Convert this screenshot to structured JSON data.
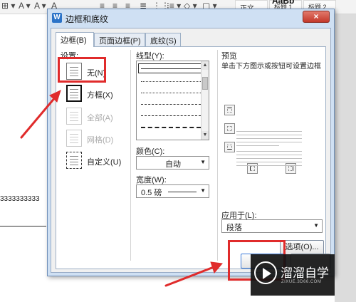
{
  "document": {
    "toolbar_glyphs": [
      "⊞ ▾",
      "A ▾",
      "A ▾",
      "A",
      "≡",
      "≡",
      "≡",
      "≣",
      "⋮⋮",
      "⁝≡ ▾",
      "◇ ▾",
      "▢ ▾"
    ],
    "style_normal": "正文",
    "style_heading1": "标题 1",
    "style_heading2": "标题 2",
    "style_preview": "AaBb",
    "body_text": "3333333333"
  },
  "dialog": {
    "title": "边框和底纹",
    "app_icon_letter": "W",
    "close_glyph": "×",
    "tabs": [
      {
        "label": "边框(B)",
        "active": true
      },
      {
        "label": "页面边框(P)",
        "active": false
      },
      {
        "label": "底纹(S)",
        "active": false
      }
    ],
    "settings_label": "设置:",
    "settings": [
      {
        "label": "无(N)",
        "enabled": true
      },
      {
        "label": "方框(X)",
        "enabled": true
      },
      {
        "label": "全部(A)",
        "enabled": false
      },
      {
        "label": "网格(D)",
        "enabled": false
      },
      {
        "label": "自定义(U)",
        "enabled": true
      }
    ],
    "line_style_label": "线型(Y):",
    "color_label": "颜色(C):",
    "color_value": "自动",
    "width_label": "宽度(W):",
    "width_value": "0.5  磅",
    "preview_label": "预览",
    "preview_hint": "单击下方图示或按钮可设置边框",
    "apply_to_label": "应用于(L):",
    "apply_to_value": "段落",
    "options_button": "选项(O)...",
    "ok_button": "",
    "cancel_button": ""
  },
  "annotations": {
    "highlight_color": "#e02b2b"
  },
  "watermark": {
    "title": "溜溜自学",
    "subtitle": "ZIXUE.3D66.COM"
  }
}
